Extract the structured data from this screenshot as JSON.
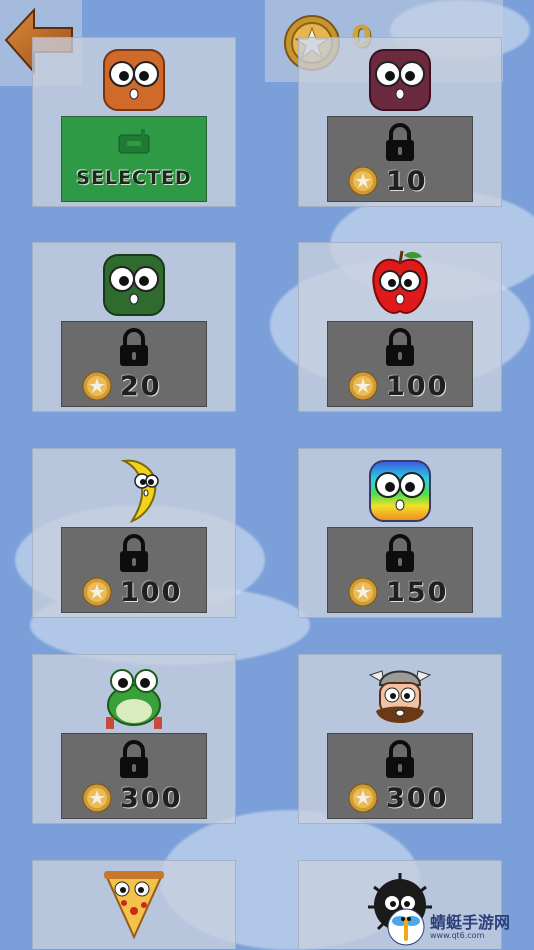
{
  "header": {
    "coin_balance": "0"
  },
  "skins": [
    {
      "name": "orange-monster",
      "status": "selected",
      "label": "SELECTED"
    },
    {
      "name": "purple-monster",
      "status": "locked",
      "price": "10"
    },
    {
      "name": "green-monster",
      "status": "locked",
      "price": "20"
    },
    {
      "name": "apple",
      "status": "locked",
      "price": "100"
    },
    {
      "name": "banana",
      "status": "locked",
      "price": "100"
    },
    {
      "name": "rainbow-monster",
      "status": "locked",
      "price": "150"
    },
    {
      "name": "frog",
      "status": "locked",
      "price": "300"
    },
    {
      "name": "viking",
      "status": "locked",
      "price": "300"
    },
    {
      "name": "pizza",
      "status": "unknown"
    },
    {
      "name": "soot-ball",
      "status": "unknown"
    }
  ],
  "watermark": {
    "text": "蜻蜓手游网",
    "sub": "www.qt6.com"
  },
  "colors": {
    "background": "#7b9fd8",
    "selected_panel": "#2e9a46",
    "locked_panel": "#6b6b6b",
    "coin": "#d9a53a"
  }
}
